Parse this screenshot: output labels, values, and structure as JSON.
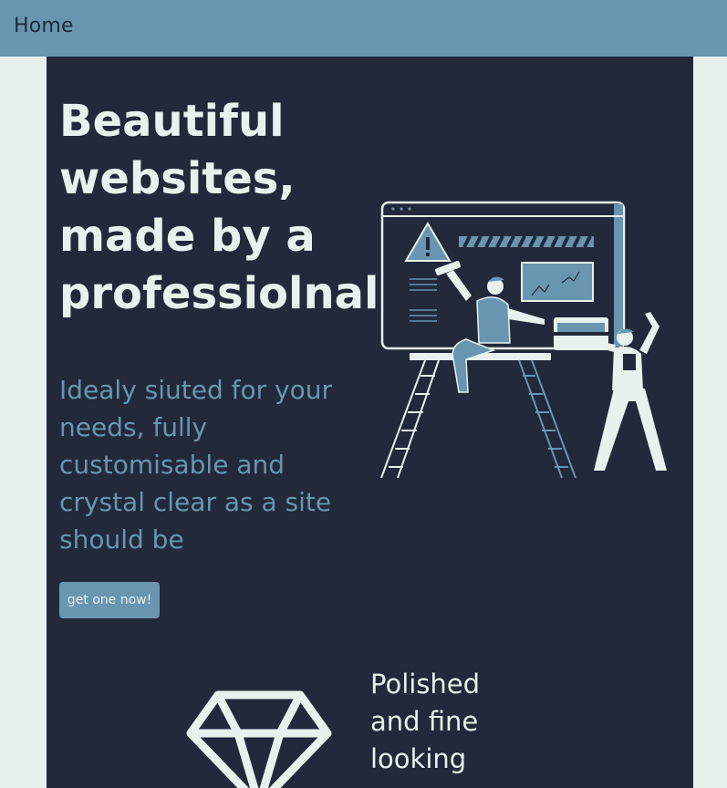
{
  "nav": {
    "home_label": "Home"
  },
  "hero": {
    "title": "Beautiful websites, made by a professiolnal",
    "subtitle": "Idealy siuted for your needs, fully customisable and crystal clear as a site should be",
    "cta_label": "get one now!"
  },
  "features": [
    {
      "title": "Polished and fine looking",
      "icon": "gem-icon"
    }
  ],
  "colors": {
    "page_bg": "#e8f1ed",
    "nav_bg": "#6896b0",
    "panel_bg": "#22293b",
    "accent": "#6896b0",
    "light_text": "#e8f1ed"
  }
}
